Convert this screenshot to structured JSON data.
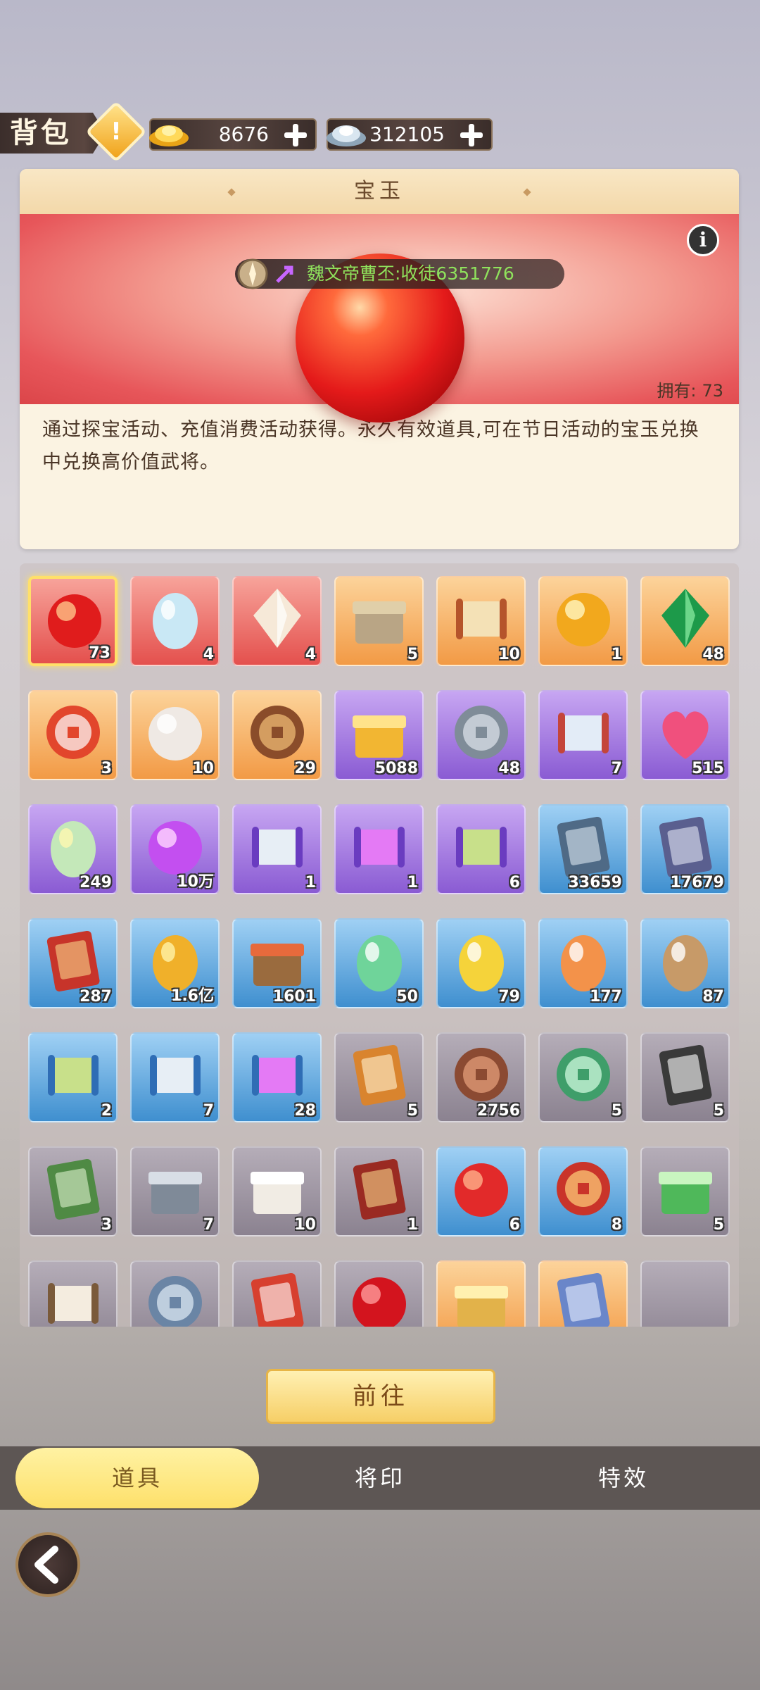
{
  "topbar": {
    "title": "背包",
    "currencies": [
      {
        "name": "gold-ingot",
        "value": "8676"
      },
      {
        "name": "silver-ingot",
        "value": "312105"
      }
    ]
  },
  "detail": {
    "header": "宝玉",
    "owner_tag": "魏文帝曹丕:收徒6351776",
    "owned_label": "拥有:",
    "owned_count": "73",
    "description": "通过探宝活动、充值消费活动获得。永久有效道具,可在节日活动的宝玉兑换中兑换高价值武将。"
  },
  "items": [
    {
      "icon": "red-jade-orb",
      "bg": "red",
      "count": "73",
      "selected": true
    },
    {
      "icon": "opal-egg",
      "bg": "red",
      "count": "4"
    },
    {
      "icon": "crystal-gem",
      "bg": "red",
      "count": "4"
    },
    {
      "icon": "treasure-chest",
      "bg": "orange",
      "count": "5"
    },
    {
      "icon": "treasure-map-scroll",
      "bg": "orange",
      "count": "10"
    },
    {
      "icon": "golden-orb",
      "bg": "orange",
      "count": "1"
    },
    {
      "icon": "green-emerald",
      "bg": "orange",
      "count": "48"
    },
    {
      "icon": "archery-target-token",
      "bg": "orange",
      "count": "3"
    },
    {
      "icon": "white-pearl",
      "bg": "orange",
      "count": "10"
    },
    {
      "icon": "bronze-badge",
      "bg": "orange",
      "count": "29"
    },
    {
      "icon": "puzzle-piece",
      "bg": "purple",
      "count": "5088"
    },
    {
      "icon": "coin-stack",
      "bg": "purple",
      "count": "48"
    },
    {
      "icon": "silk-scroll",
      "bg": "purple",
      "count": "7"
    },
    {
      "icon": "pink-heart",
      "bg": "purple",
      "count": "515"
    },
    {
      "icon": "rainbow-egg",
      "bg": "purple",
      "count": "249"
    },
    {
      "icon": "purple-flame",
      "bg": "purple",
      "count": "10万"
    },
    {
      "icon": "silver-scroll-8h",
      "bg": "purple",
      "count": "1"
    },
    {
      "icon": "flame-scroll-8h",
      "bg": "purple",
      "count": "1"
    },
    {
      "icon": "box-scroll-8h",
      "bg": "purple",
      "count": "6"
    },
    {
      "icon": "luck-card",
      "bg": "blue",
      "count": "33659"
    },
    {
      "icon": "swap-general-card",
      "bg": "blue",
      "count": "17679"
    },
    {
      "icon": "edict-plaque",
      "bg": "blue",
      "count": "287"
    },
    {
      "icon": "golden-bean",
      "bg": "blue",
      "count": "1.6亿"
    },
    {
      "icon": "fruit-basket",
      "bg": "blue",
      "count": "1601"
    },
    {
      "icon": "green-egg",
      "bg": "blue",
      "count": "50"
    },
    {
      "icon": "yellow-egg",
      "bg": "blue",
      "count": "79"
    },
    {
      "icon": "orange-egg",
      "bg": "blue",
      "count": "177"
    },
    {
      "icon": "cracked-egg",
      "bg": "blue",
      "count": "87"
    },
    {
      "icon": "box-scroll-2h",
      "bg": "blue",
      "count": "2"
    },
    {
      "icon": "silver-scroll-2h",
      "bg": "blue",
      "count": "7"
    },
    {
      "icon": "flame-scroll-2h",
      "bg": "blue",
      "count": "28"
    },
    {
      "icon": "challenge-letter",
      "bg": "gray",
      "count": "5"
    },
    {
      "icon": "fist-medal",
      "bg": "gray",
      "count": "2756"
    },
    {
      "icon": "fate-pendant",
      "bg": "gray",
      "count": "5"
    },
    {
      "icon": "chaos-talisman",
      "bg": "gray",
      "count": "5"
    },
    {
      "icon": "steal-ticket",
      "bg": "gray",
      "count": "3"
    },
    {
      "icon": "fish-tin",
      "bg": "gray",
      "count": "7"
    },
    {
      "icon": "dice",
      "bg": "gray",
      "count": "10"
    },
    {
      "icon": "duel-plaque",
      "bg": "gray",
      "count": "1"
    },
    {
      "icon": "red-lantern",
      "bg": "blue",
      "count": "6"
    },
    {
      "icon": "new-year-badge",
      "bg": "blue",
      "count": "8"
    },
    {
      "icon": "jade-armor",
      "bg": "gray",
      "count": "5"
    },
    {
      "icon": "calligraphy-scroll",
      "bg": "gray",
      "count": ""
    },
    {
      "icon": "palace-coin",
      "bg": "gray",
      "count": ""
    },
    {
      "icon": "challenge-scroll",
      "bg": "gray",
      "count": ""
    },
    {
      "icon": "cherry",
      "bg": "gray",
      "count": ""
    },
    {
      "icon": "golden-beast",
      "bg": "orange",
      "count": ""
    },
    {
      "icon": "dragon-command",
      "bg": "orange",
      "count": ""
    },
    {
      "icon": "empty-slot",
      "bg": "gray",
      "count": ""
    }
  ],
  "goto_button": "前往",
  "tabs": [
    {
      "label": "道具",
      "active": true
    },
    {
      "label": "将印",
      "active": false
    },
    {
      "label": "特效",
      "active": false
    }
  ],
  "colors": {
    "accent_yellow": "#fde06a",
    "count_text": "#ffffff",
    "owner_tag_text": "#8fe25c"
  }
}
